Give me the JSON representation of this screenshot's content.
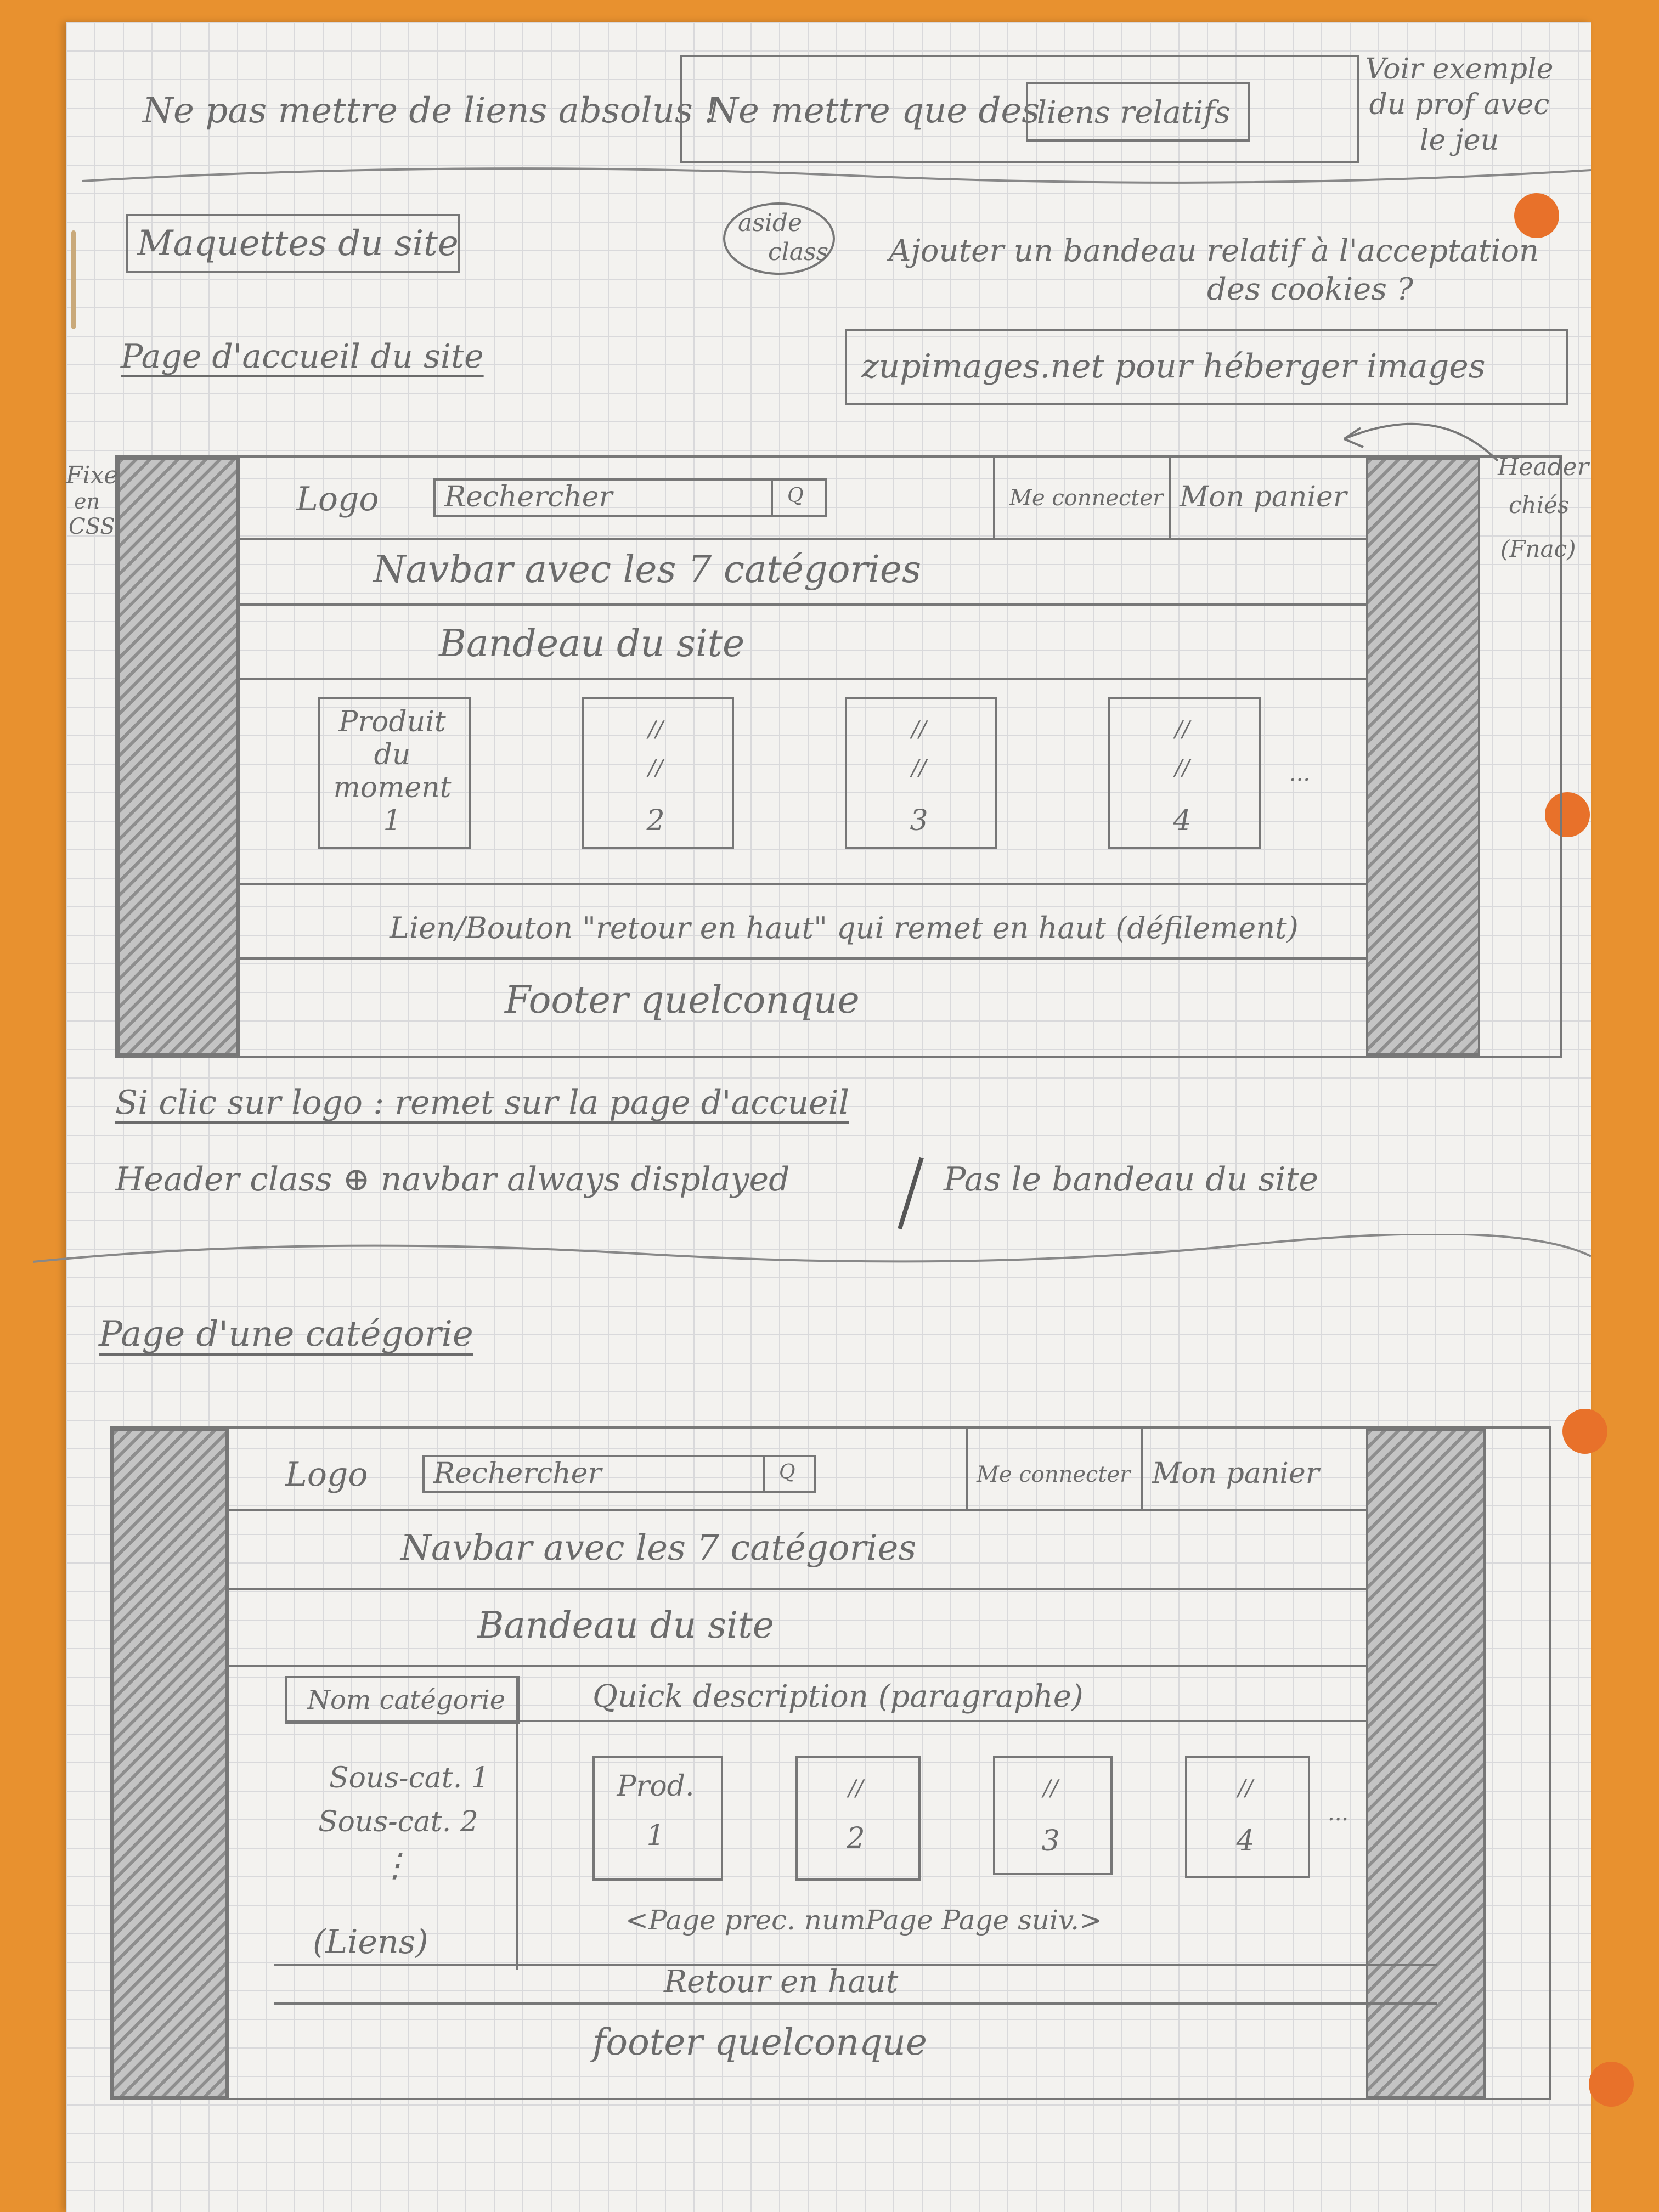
{
  "top": {
    "absolute_note": "Ne pas mettre de liens absolus !",
    "relative_note_prefix": "Ne mettre que des",
    "relative_links": "liens relatifs",
    "prof_note_l1": "Voir exemple",
    "prof_note_l2": "du prof avec",
    "prof_note_l3": "le jeu"
  },
  "section1": {
    "title": "Maquettes du site",
    "aside_l1": "aside",
    "aside_l2": "class",
    "cookies_l1": "Ajouter un bandeau relatif à l'acceptation",
    "cookies_l2": "des cookies ?",
    "home_title": "Page d'accueil du site",
    "zupimages": "zupimages.net pour héberger images",
    "fixe_l1": "Fixe",
    "fixe_l2": "en",
    "fixe_l3": "CSS",
    "header_note_l1": "Header",
    "header_note_l2": "chiés",
    "header_note_l3": "(Fnac)"
  },
  "home_mockup": {
    "logo": "Logo",
    "search": "Rechercher",
    "search_icon": "Q",
    "login": "Me connecter",
    "cart": "Mon panier",
    "navbar": "Navbar avec les 7 catégories",
    "banner": "Bandeau du site",
    "product1_l1": "Produit",
    "product1_l2": "du",
    "product1_l3": "moment",
    "product1_num": "1",
    "ditto": "//",
    "product2_num": "2",
    "product3_num": "3",
    "product4_num": "4",
    "more": "...",
    "back_to_top": "Lien/Bouton \"retour en haut\" qui remet en haut (défilement)",
    "footer": "Footer quelconque"
  },
  "notes": {
    "logo_click": "Si clic sur logo : remet sur la page d'accueil",
    "header_class": "Header class ⊕ navbar always displayed",
    "no_banner": "Pas le bandeau du site"
  },
  "category_page": {
    "title": "Page d'une catégorie",
    "logo": "Logo",
    "search": "Rechercher",
    "search_icon": "Q",
    "login": "Me connecter",
    "cart": "Mon panier",
    "navbar": "Navbar avec les 7 catégories",
    "banner": "Bandeau du site",
    "category_name": "Nom catégorie",
    "description": "Quick description (paragraphe)",
    "subcat1": "Sous-cat. 1",
    "subcat2": "Sous-cat. 2",
    "vdots": "⋮",
    "links": "(Liens)",
    "prod_l1": "Prod.",
    "ditto": "//",
    "num1": "1",
    "num2": "2",
    "num3": "3",
    "num4": "4",
    "more": "...",
    "pagination": "<Page prec.  numPage  Page suiv.>",
    "back_to_top": "Retour en haut",
    "footer": "footer quelconque"
  }
}
